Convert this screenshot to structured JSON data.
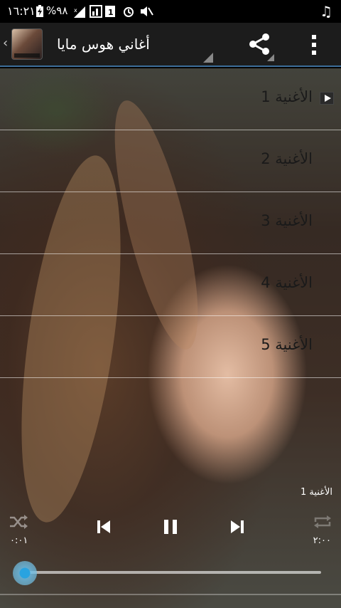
{
  "status_bar": {
    "time": "١٦:٢١",
    "battery": "%٩٨"
  },
  "app_bar": {
    "title": "أغاني هوس مايا"
  },
  "songs": [
    {
      "label": "الأغنية 1",
      "playing": true
    },
    {
      "label": "الأغنية 2",
      "playing": false
    },
    {
      "label": "الأغنية 3",
      "playing": false
    },
    {
      "label": "الأغنية 4",
      "playing": false
    },
    {
      "label": "الأغنية 5",
      "playing": false
    }
  ],
  "player": {
    "now_playing": "الأغنية 1",
    "elapsed": "٠:٠١",
    "duration": "٢:٠٠",
    "progress": 0.008
  },
  "colors": {
    "accent": "#3d6e9a",
    "seek_thumb": "#29a3e0"
  }
}
